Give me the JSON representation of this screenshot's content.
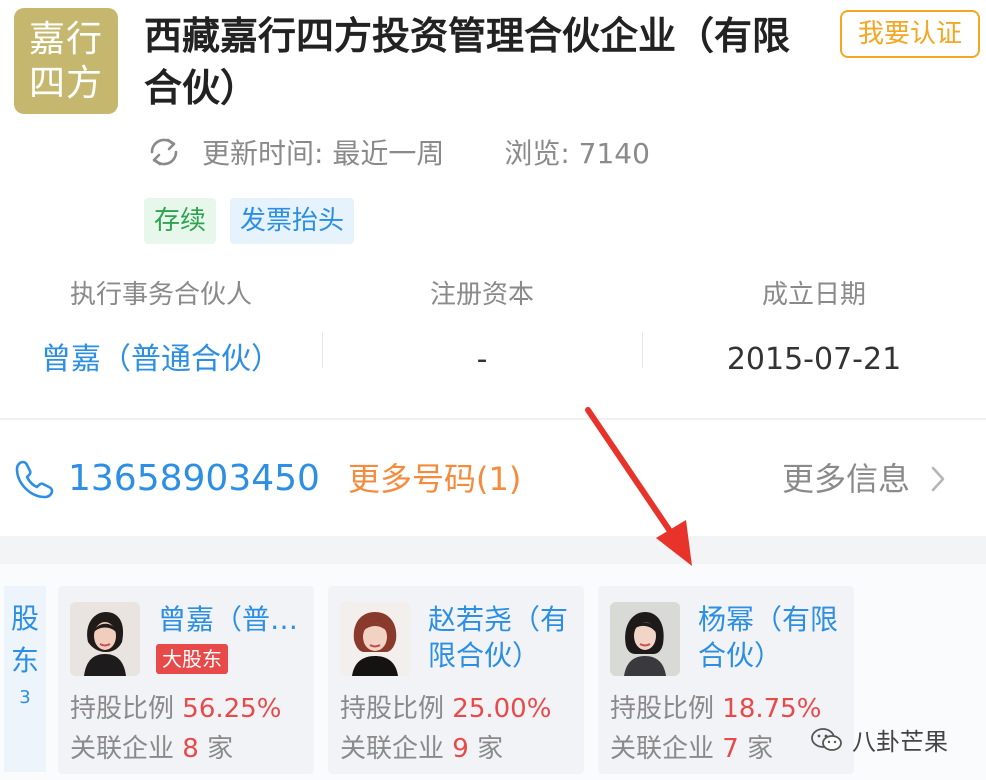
{
  "header": {
    "logo_line1": "嘉行",
    "logo_line2": "四方",
    "company_name": "西藏嘉行四方投资管理合伙企业（有限合伙）",
    "certify_button": "我要认证",
    "updated_text": "更新时间: 最近一周",
    "views_text": "浏览: 7140",
    "tags": [
      "存续",
      "发票抬头"
    ]
  },
  "info": {
    "partner_label": "执行事务合伙人",
    "partner_value": "曾嘉（普通合伙）",
    "capital_label": "注册资本",
    "capital_value": "-",
    "date_label": "成立日期",
    "date_value": "2015-07-21"
  },
  "contact": {
    "phone": "13658903450",
    "more_phones": "更多号码(1)",
    "more_info": "更多信息"
  },
  "shareholders": {
    "label_line1": "股",
    "label_line2": "东",
    "count": "3",
    "ratio_label": "持股比例",
    "related_label": "关联企业",
    "unit": "家",
    "major_badge": "大股东",
    "items": [
      {
        "name": "曾嘉（普…",
        "ratio": "56.25%",
        "related": "8"
      },
      {
        "name": "赵若尧（有限合伙）",
        "ratio": "25.00%",
        "related": "9"
      },
      {
        "name": "杨幂（有限合伙）",
        "ratio": "18.75%",
        "related": "7"
      }
    ]
  },
  "watermark": "八卦芒果",
  "colors": {
    "accent_blue": "#2c8fe3",
    "orange": "#f58b3c",
    "red": "#e84a4a",
    "logo_gold": "#c5b86e",
    "arrow_red": "#e8332a"
  }
}
